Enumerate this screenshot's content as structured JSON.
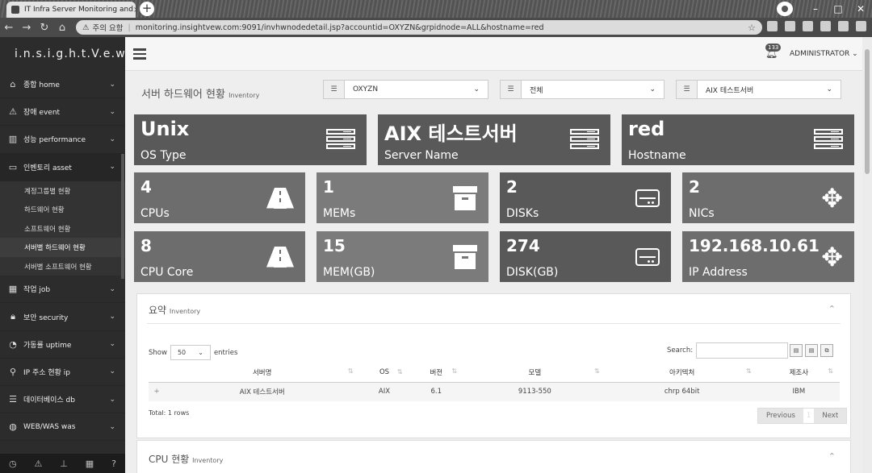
{
  "browser": {
    "tab_title": "IT Infra Server Monitoring and",
    "tab_close": "×",
    "new_tab": "+",
    "security_warning": "주의 요함",
    "url": "monitoring.insightvew.com:9091/invhwnodedetail.jsp?accountid=OXYZN&grpidnode=ALL&hostname=red"
  },
  "sidebar": {
    "brand": "i.n.s.i.g.h.t.V.e.w",
    "items": [
      {
        "label": "종합 home",
        "icon": "home-icon"
      },
      {
        "label": "장애 event",
        "icon": "warning-icon"
      },
      {
        "label": "성능 performance",
        "icon": "bar-chart-icon"
      },
      {
        "label": "인벤토리 asset",
        "icon": "desktop-icon"
      }
    ],
    "subitems": [
      "계정그룹별 현황",
      "하드웨어 현황",
      "소프트웨어 현황",
      "서버별 하드웨어 현황",
      "서버별 소프트웨어 현황"
    ],
    "items_after": [
      {
        "label": "작업 job",
        "icon": "calendar-icon"
      },
      {
        "label": "보안 security",
        "icon": "lock-icon"
      },
      {
        "label": "가동률 uptime",
        "icon": "dashboard-icon"
      },
      {
        "label": "IP 주소 현황 ip",
        "icon": "pin-icon"
      },
      {
        "label": "데이터베이스 db",
        "icon": "database-icon"
      },
      {
        "label": "WEB/WAS was",
        "icon": "globe-icon"
      }
    ]
  },
  "topbar": {
    "notification_count": "133",
    "user": "ADMINISTRATOR"
  },
  "page": {
    "title": "서버 하드웨어 현황",
    "subtitle": "Inventory",
    "select_account": "OXYZN",
    "select_group": "전체",
    "select_server": "AIX 테스트서버"
  },
  "cards": [
    {
      "value": "Unix",
      "label": "OS Type"
    },
    {
      "value": "AIX 테스트서버",
      "label": "Server Name"
    },
    {
      "value": "red",
      "label": "Hostname"
    },
    {
      "value": "4",
      "label": "CPUs"
    },
    {
      "value": "1",
      "label": "MEMs"
    },
    {
      "value": "2",
      "label": "DISKs"
    },
    {
      "value": "2",
      "label": "NICs"
    },
    {
      "value": "8",
      "label": "CPU Core"
    },
    {
      "value": "15",
      "label": "MEM(GB)"
    },
    {
      "value": "274",
      "label": "DISK(GB)"
    },
    {
      "value": "192.168.10.61",
      "label": "IP Address"
    }
  ],
  "summary": {
    "title": "요약",
    "subtitle": "Inventory",
    "show_label": "Show",
    "entries_value": "50",
    "entries_label": "entries",
    "search_label": "Search:",
    "columns": [
      "서버명",
      "OS",
      "버전",
      "모델",
      "아키텍처",
      "제조사"
    ],
    "rows": [
      {
        "plus": "+",
        "cells": [
          "AIX 테스트서버",
          "AIX",
          "6.1",
          "9113-550",
          "chrp 64bit",
          "IBM"
        ]
      }
    ],
    "total": "Total: 1 rows",
    "prev": "Previous",
    "page": "1",
    "next": "Next"
  },
  "cpu_panel": {
    "title": "CPU 현황",
    "subtitle": "Inventory"
  }
}
